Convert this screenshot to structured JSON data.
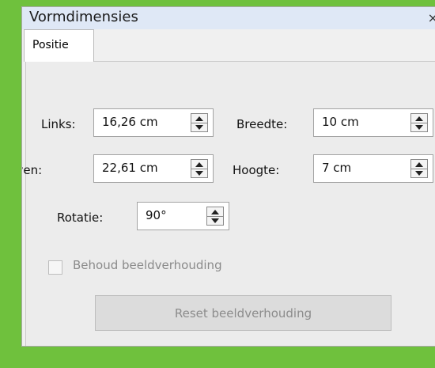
{
  "dialog": {
    "title": "Vormdimensies",
    "close_glyph": "×"
  },
  "tabs": [
    {
      "label": "Positie",
      "selected": true
    }
  ],
  "fields": {
    "links": {
      "label": "Links:",
      "value": "16,26 cm"
    },
    "breedte": {
      "label": "Breedte:",
      "value": "10 cm"
    },
    "boven": {
      "label": "Boven:",
      "value": "22,61 cm"
    },
    "hoogte": {
      "label": "Hoogte:",
      "value": "7 cm"
    },
    "rotatie": {
      "label": "Rotatie:",
      "value": "90°"
    }
  },
  "aspect": {
    "checkbox_label": "Behoud beeldverhouding",
    "checked": false,
    "enabled": false
  },
  "reset_button": {
    "label": "Reset beeldverhouding",
    "enabled": false
  },
  "colors": {
    "background": "#6fc13d",
    "dialog_bg": "#f0f0f0",
    "disabled_text": "#8a8a8a"
  }
}
